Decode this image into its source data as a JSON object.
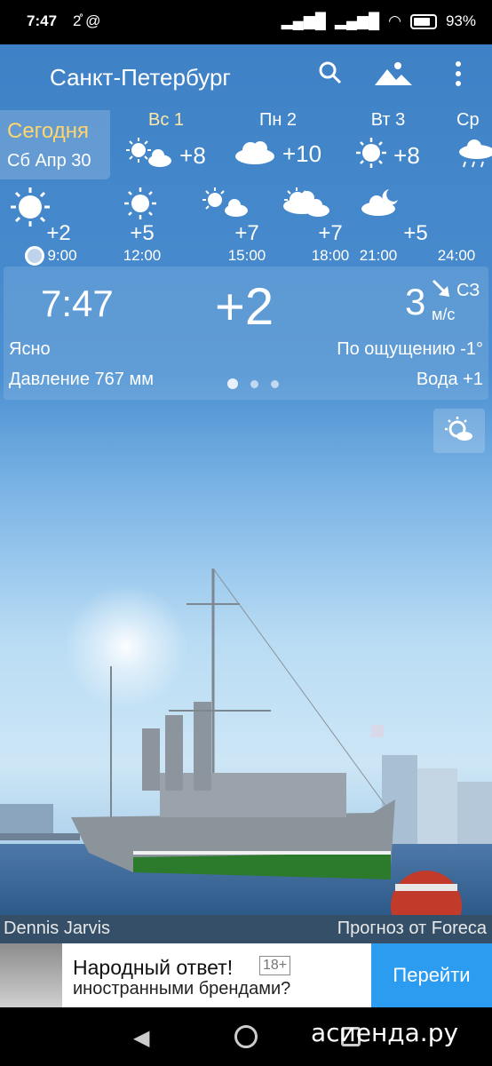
{
  "status_bar": {
    "time": "7:47",
    "misc": "2̊ @",
    "battery": "93%"
  },
  "header": {
    "city": "Санкт-Петербург",
    "icons": [
      "search-icon",
      "landscape-icon",
      "more-vert-icon"
    ]
  },
  "days": [
    {
      "name": "Сегодня",
      "date": "Сб Апр 30"
    },
    {
      "label": "Вс 1",
      "temp": "+8",
      "icon": "sun-cloud"
    },
    {
      "label": "Пн 2",
      "temp": "+10",
      "icon": "cloud"
    },
    {
      "label": "Вт 3",
      "temp": "+8",
      "icon": "sun"
    },
    {
      "label": "Ср",
      "temp": "",
      "icon": "rain-cloud"
    }
  ],
  "hourly": [
    {
      "temp": "+2",
      "time": "9:00",
      "icon": "sun"
    },
    {
      "temp": "+5",
      "time": "12:00",
      "icon": "sun"
    },
    {
      "temp": "+7",
      "time": "15:00",
      "icon": "sun-cloud"
    },
    {
      "temp": "+7",
      "time": "18:00",
      "icon": "sun-cloud"
    },
    {
      "temp": "+5",
      "time": "21:00",
      "icon": "cloud"
    },
    {
      "temp": "",
      "time": "24:00",
      "icon": "night-cloud"
    }
  ],
  "current": {
    "time": "7:47",
    "temp": "+2",
    "wind_speed": "3",
    "wind_dir": "СЗ",
    "wind_unit": "м/с",
    "condition": "Ясно",
    "feels_like": "По ощущению -1°",
    "pressure": "Давление 767 мм",
    "water": "Вода +1"
  },
  "photo": {
    "author": "Dennis Jarvis",
    "source": "Прогноз от Foreca"
  },
  "ad": {
    "title": "Народный ответ!",
    "badge": "18+",
    "subtitle": "иностранными брендами?",
    "button": "Перейти"
  },
  "watermark": "асиенда.ру"
}
